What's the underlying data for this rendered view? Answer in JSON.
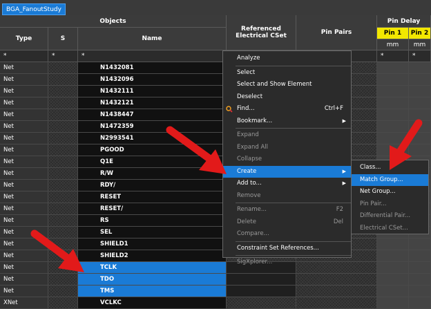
{
  "tab": "BGA_FanoutStudy",
  "headers": {
    "objects": "Objects",
    "type": "Type",
    "s": "S",
    "name": "Name",
    "ref_cset": "Referenced Electrical CSet",
    "pin_pairs": "Pin Pairs",
    "pin_delay": "Pin Delay",
    "pin1": "Pin 1",
    "pin2": "Pin 2",
    "unit1": "mm",
    "unit2": "mm"
  },
  "filter": {
    "type": "*",
    "s": "*",
    "name": "*",
    "p1": "*",
    "p2": "*"
  },
  "rows": [
    {
      "type": "Net",
      "name": "N1432081"
    },
    {
      "type": "Net",
      "name": "N1432096"
    },
    {
      "type": "Net",
      "name": "N1432111"
    },
    {
      "type": "Net",
      "name": "N1432121"
    },
    {
      "type": "Net",
      "name": "N1438447"
    },
    {
      "type": "Net",
      "name": "N1472359"
    },
    {
      "type": "Net",
      "name": "N2993541"
    },
    {
      "type": "Net",
      "name": "PGOOD"
    },
    {
      "type": "Net",
      "name": "Q1E"
    },
    {
      "type": "Net",
      "name": "R/W"
    },
    {
      "type": "Net",
      "name": "RDY/"
    },
    {
      "type": "Net",
      "name": "RESET"
    },
    {
      "type": "Net",
      "name": "RESET/"
    },
    {
      "type": "Net",
      "name": "RS"
    },
    {
      "type": "Net",
      "name": "SEL"
    },
    {
      "type": "Net",
      "name": "SHIELD1"
    },
    {
      "type": "Net",
      "name": "SHIELD2"
    },
    {
      "type": "Net",
      "name": "TCLK"
    },
    {
      "type": "Net",
      "name": "TDO"
    },
    {
      "type": "Net",
      "name": "TMS"
    },
    {
      "type": "XNet",
      "name": "VCLKC"
    }
  ],
  "context_menu": [
    {
      "label": "Analyze",
      "disabled": false
    },
    {
      "sep": true
    },
    {
      "label": "Select",
      "disabled": false
    },
    {
      "label": "Select and Show Element",
      "disabled": false
    },
    {
      "label": "Deselect",
      "disabled": false
    },
    {
      "label": "Find...",
      "shortcut": "Ctrl+F",
      "icon": "find-icon",
      "disabled": false
    },
    {
      "label": "Bookmark...",
      "submenu": true,
      "disabled": false
    },
    {
      "sep": true
    },
    {
      "label": "Expand",
      "disabled": true
    },
    {
      "label": "Expand All",
      "disabled": true
    },
    {
      "label": "Collapse",
      "disabled": true
    },
    {
      "label": "Create",
      "submenu": true,
      "highlighted": true,
      "disabled": false
    },
    {
      "label": "Add to...",
      "submenu": true,
      "disabled": false
    },
    {
      "label": "Remove",
      "disabled": true
    },
    {
      "sep": true
    },
    {
      "label": "Rename...",
      "shortcut": "F2",
      "disabled": true
    },
    {
      "label": "Delete",
      "shortcut": "Del",
      "disabled": true
    },
    {
      "label": "Compare...",
      "disabled": true
    },
    {
      "sep": true
    },
    {
      "label": "Constraint Set References...",
      "disabled": false
    },
    {
      "sep": true
    },
    {
      "label": "SigXplorer...",
      "disabled": true
    }
  ],
  "submenu": [
    {
      "label": "Class...",
      "disabled": false
    },
    {
      "label": "Match Group...",
      "disabled": false,
      "highlighted": true
    },
    {
      "label": "Net Group...",
      "disabled": false
    },
    {
      "label": "Pin Pair...",
      "disabled": true
    },
    {
      "label": "Differential Pair...",
      "disabled": true
    },
    {
      "label": "Electrical CSet...",
      "disabled": true
    }
  ],
  "colors": {
    "accent": "#1a7bd6",
    "yellow": "#f2e700",
    "arrow": "#e21a1a"
  },
  "icons": {
    "arrow": "submenu-arrow-icon",
    "find": "find-icon"
  }
}
